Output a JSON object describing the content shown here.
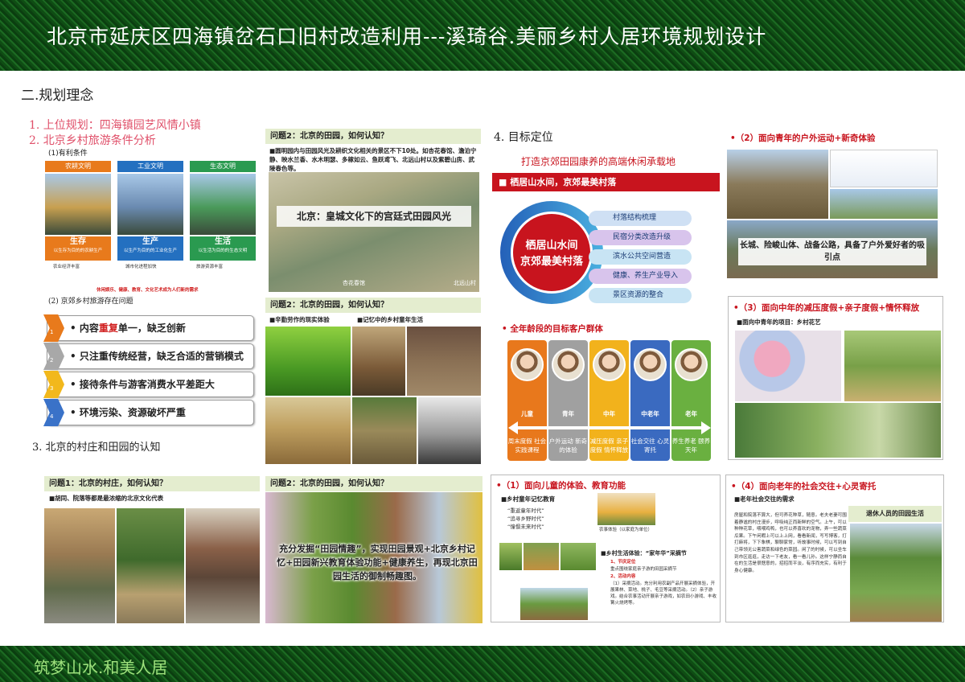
{
  "header": {
    "title": "北京市延庆区四海镇岔石口旧村改造利用---溪琦谷.美丽乡村人居环境规划设计"
  },
  "footer": {
    "slogan": "筑梦山水.和美人居"
  },
  "section2": {
    "title": "二.规划理念"
  },
  "col1": {
    "item1": "1. 上位规划：四海镇园艺风情小镇",
    "item2": "2. 北京乡村旅游条件分析",
    "sub1": "(1)有利条件",
    "civs": [
      {
        "name": "农耕文明",
        "color": "#e87a1c",
        "key": "生存",
        "desc": "以生存为目的的农耕生产"
      },
      {
        "name": "工业文明",
        "color": "#2470c0",
        "key": "生产",
        "desc": "以生产为目的的工业化生产"
      },
      {
        "name": "生态文明",
        "color": "#2a9a50",
        "key": "生活",
        "desc": "以生活为目的的生态文明"
      }
    ],
    "civ_bullets": [
      "农业经济丰富",
      "城市化进程加快",
      "旅游资源丰富"
    ],
    "red_line": "休闲娱乐、健康、教育、文化艺术成为人们新的需求",
    "sub2": "(2) 京郊乡村旅游存在问题",
    "problems": [
      {
        "num": "1",
        "pre": "• 内容",
        "red": "重复",
        "post": "单一，缺乏创新",
        "color": "#e87a1c"
      },
      {
        "num": "2",
        "pre": "• 只注重传统经营，缺乏合适的营销模式",
        "red": "",
        "post": "",
        "color": "#a8a8a8"
      },
      {
        "num": "3",
        "pre": "• 接待条件与游客消费水平差距大",
        "red": "",
        "post": "",
        "color": "#f2b81c"
      },
      {
        "num": "4",
        "pre": "• 环境污染、资源破坏严重",
        "red": "",
        "post": "",
        "color": "#3a72c8"
      }
    ],
    "item3": "3. 北京的村庄和田园的认知",
    "q1_bar": "问题1：北京的村庄，如何认知？",
    "q1_sub": "■胡同、院落等都是最浓缩的北京文化代表"
  },
  "col2": {
    "q2a_bar": "问题2：北京的田园，如何认知？",
    "q2a_text": "■圆明园内与田园风光及耕织文化相关的景区不下10处。如杏花春馆、澹泊宁静、映水兰香、水木明瑟、多稼如云、鱼跃鸢飞、北远山村以及紫碧山房、武陵春色等。",
    "painting_caption": "北京：皇城文化下的宫廷式田园风光",
    "painting_label1": "杏花春馆",
    "painting_label2": "北远山村",
    "q2b_bar": "问题2：北京的田园，如何认知？",
    "q2b_sub1": "■辛勤劳作的现实体验",
    "q2b_sub2": "■记忆中的乡村童年生活",
    "q2c_bar": "问题2：北京的田园，如何认知？",
    "q2c_text": "充分发掘“田园情趣”，实现田园景观+北京乡村记忆+田园新兴教育体验功能+健康养生，再现北京田园生活的御制畅趣图。"
  },
  "col3": {
    "title": "4. 目标定位",
    "subtitle": "打造京郊田园康养的高端休闲承载地",
    "banner": "■ 栖居山水间，京郊最美村落",
    "circle_text": [
      "栖居山水间",
      "京郊最美村落"
    ],
    "pills": [
      "村落结构梳理",
      "民宿分类改造升级",
      "滨水公共空间营造",
      "健康、养生产业导入",
      "景区资源的整合"
    ],
    "ages_title": "• 全年龄段的目标客户群体",
    "ages": [
      {
        "label": "儿童",
        "desc": "周末度假 社会实践课程",
        "color": "#e8781c"
      },
      {
        "label": "青年",
        "desc": "户外运动 新奇的体验",
        "color": "#a0a0a0"
      },
      {
        "label": "中年",
        "desc": "减压度假 亲子度假 情怀释放",
        "color": "#f2b21c"
      },
      {
        "label": "中老年",
        "desc": "社会交往 心灵寄托",
        "color": "#3a6ac0"
      },
      {
        "label": "老年",
        "desc": "养生养老 颐养天年",
        "color": "#6ab040"
      }
    ]
  },
  "kids": {
    "title": "•（1）面向儿童的体验、教育功能",
    "sub": "■乡村童年记忆教育",
    "lines": [
      "“重返童年时代”",
      "“追寻乡野时代”",
      "“憧憬未来时代”"
    ],
    "caption": "农事体验（以家庭为单位）",
    "sub2": "■乡村生活体验：“家年华”采摘节",
    "h1": "1、节庆定位",
    "t1": "重点围绕家庭亲子游的田园采摘节",
    "h2": "2、活动内容",
    "t2": "（1）采摘活动。充分利用农副产品开展采摘体验，开展果林、菜地、桃子、毛豆等采摘活动。（2）亲子游戏。结合农事活动开展亲子游戏，如农田小游戏、丰收篝火烧烤等。"
  },
  "youth": {
    "title": "•（2）面向青年的户外运动+新奇体验",
    "caption": "长城、险峻山体、战备公路，具备了户外爱好者的吸引点"
  },
  "middle": {
    "title": "•（3）面向中年的减压度假+亲子度假+情怀释放",
    "sub": "■面向中青年的项目：乡村花艺"
  },
  "elder": {
    "title": "•（4）面向老年的社会交往+心灵寄托",
    "sub": "■老年社会交往的需求",
    "tag": "退休人员的田园生活",
    "para": "房屋和院落不算大，但可养花种草，随意。老夫老妻可围着静谧的村庄漫步，呼吸纯正而新鲜的空气。上午，可以种种花草，喂喂鸡鸭，也可以养喜欢的宠物，弄一些蔬菜瓜果。下午闲暇上可以上上网，看看新闻，写写博客，打打麻将，下下象棋，聊聊家常，听故事时候，可以写到自己带领无公害蔬菜和绿色的菜园。闲了的时候，可以坐车到市区逛逛，走访一下老友，看一看儿孙。这样宁静而自在的生活是很惬意的，招招而平淡，有序而充实，有利于身心健康。"
  },
  "colors": {
    "header_green": "#145a1a",
    "accent_red": "#c8141e",
    "pink": "#e0506a",
    "pale_green": "#e4edcf"
  }
}
